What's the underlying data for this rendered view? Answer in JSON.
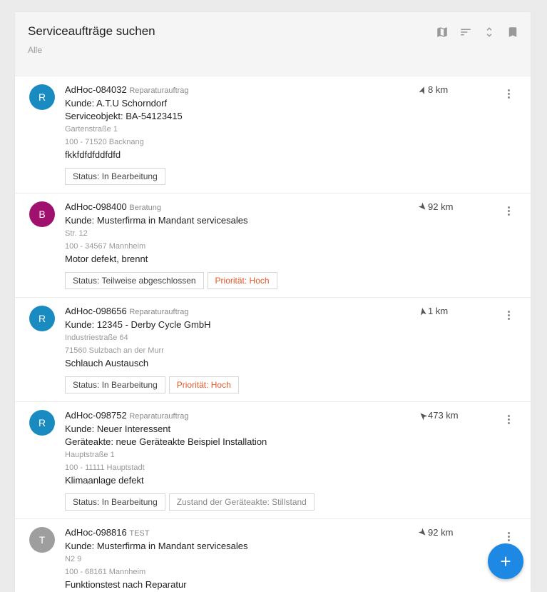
{
  "header": {
    "title": "Serviceaufträge suchen",
    "subtitle": "Alle",
    "tools": [
      "map-icon",
      "sort-icon",
      "expand-icon",
      "bookmark-icon"
    ]
  },
  "orders": [
    {
      "avatar": "R",
      "avatar_color": "#1a8bc1",
      "id": "AdHoc-084032",
      "type": "Reparaturauftrag",
      "customer": "Kunde: A.T.U Schorndorf",
      "object": "Serviceobjekt: BA-54123415",
      "street": "Gartenstraße 1",
      "city": "100 - 71520 Backnang",
      "description": "fkkfdfdfddfdfd",
      "distance": "8 km",
      "direction_deg": 20,
      "chips": [
        {
          "label": "Status: In Bearbeitung",
          "kind": "normal"
        }
      ]
    },
    {
      "avatar": "B",
      "avatar_color": "#a0106f",
      "id": "AdHoc-098400",
      "type": "Beratung",
      "customer": "Kunde: Musterfirma in Mandant servicesales",
      "object": "",
      "street": "Str. 12",
      "city": "100 - 34567 Mannheim",
      "description": "Motor defekt, brennt",
      "distance": "92 km",
      "direction_deg": 135,
      "chips": [
        {
          "label": "Status: Teilweise abgeschlossen",
          "kind": "normal"
        },
        {
          "label": "Priorität: Hoch",
          "kind": "warn"
        }
      ]
    },
    {
      "avatar": "R",
      "avatar_color": "#1a8bc1",
      "id": "AdHoc-098656",
      "type": "Reparaturauftrag",
      "customer": "Kunde: 12345 - Derby Cycle GmbH",
      "object": "",
      "street": "Industriestraße 64",
      "city": "71560 Sulzbach an der Murr",
      "description": "Schlauch Austausch",
      "distance": "1 km",
      "direction_deg": -10,
      "chips": [
        {
          "label": "Status: In Bearbeitung",
          "kind": "normal"
        },
        {
          "label": "Priorität: Hoch",
          "kind": "warn"
        }
      ]
    },
    {
      "avatar": "R",
      "avatar_color": "#1a8bc1",
      "id": "AdHoc-098752",
      "type": "Reparaturauftrag",
      "customer": "Kunde: Neuer Interessent",
      "object": "Geräteakte: neue Geräteakte Beispiel Installation",
      "street": "Hauptstraße 1",
      "city": "100 - 11111 Hauptstadt",
      "description": "Klimaanlage defekt",
      "distance": "473 km",
      "direction_deg": -45,
      "chips": [
        {
          "label": "Status: In Bearbeitung",
          "kind": "normal"
        },
        {
          "label": "Zustand der Geräteakte: Stillstand",
          "kind": "muted"
        }
      ]
    },
    {
      "avatar": "T",
      "avatar_color": "#9e9e9e",
      "id": "AdHoc-098816",
      "type": "TEST",
      "customer": "Kunde: Musterfirma in Mandant servicesales",
      "object": "",
      "street": "N2 9",
      "city": "100 - 68161 Mannheim",
      "description": "Funktionstest nach Reparatur",
      "distance": "92 km",
      "direction_deg": 135,
      "chips": []
    }
  ],
  "fab": {
    "label": "+"
  }
}
